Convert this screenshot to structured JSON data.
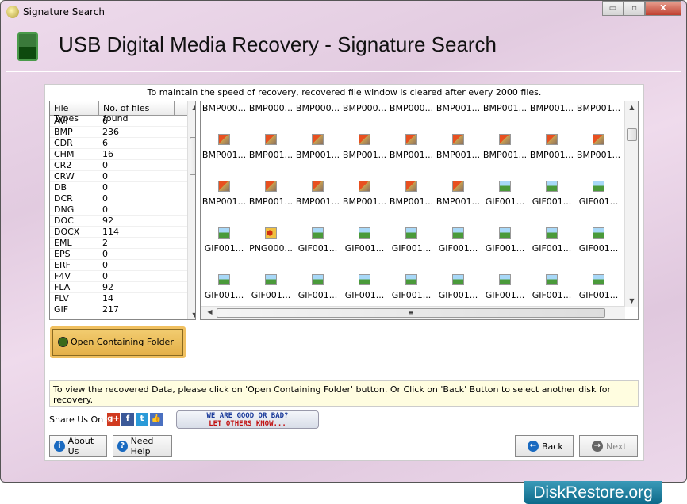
{
  "window": {
    "title": "Signature Search",
    "controls": {
      "minimize": "▭",
      "maximize": "▫",
      "close": "X"
    }
  },
  "header": {
    "title": "USB Digital Media Recovery - Signature Search",
    "icon": "chip-icon"
  },
  "notice": "To maintain the speed of recovery, recovered file window is cleared after every 2000 files.",
  "file_list": {
    "headers": [
      "File Types",
      "No. of files found"
    ],
    "rows": [
      [
        "AVI",
        "6"
      ],
      [
        "BMP",
        "236"
      ],
      [
        "CDR",
        "6"
      ],
      [
        "CHM",
        "16"
      ],
      [
        "CR2",
        "0"
      ],
      [
        "CRW",
        "0"
      ],
      [
        "DB",
        "0"
      ],
      [
        "DCR",
        "0"
      ],
      [
        "DNG",
        "0"
      ],
      [
        "DOC",
        "92"
      ],
      [
        "DOCX",
        "114"
      ],
      [
        "EML",
        "2"
      ],
      [
        "EPS",
        "0"
      ],
      [
        "ERF",
        "0"
      ],
      [
        "F4V",
        "0"
      ],
      [
        "FLA",
        "92"
      ],
      [
        "FLV",
        "14"
      ],
      [
        "GIF",
        "217"
      ]
    ]
  },
  "file_grid": {
    "rows": [
      {
        "icons": false,
        "items": [
          {
            "label": "BMP000...",
            "type": "bmp"
          },
          {
            "label": "BMP000...",
            "type": "bmp"
          },
          {
            "label": "BMP000...",
            "type": "bmp"
          },
          {
            "label": "BMP000...",
            "type": "bmp"
          },
          {
            "label": "BMP000...",
            "type": "bmp"
          },
          {
            "label": "BMP001...",
            "type": "bmp"
          },
          {
            "label": "BMP001...",
            "type": "bmp"
          },
          {
            "label": "BMP001...",
            "type": "bmp"
          },
          {
            "label": "BMP001...",
            "type": "bmp"
          }
        ]
      },
      {
        "icons": true,
        "items": [
          {
            "label": "BMP001...",
            "type": "bmp"
          },
          {
            "label": "BMP001...",
            "type": "bmp"
          },
          {
            "label": "BMP001...",
            "type": "bmp"
          },
          {
            "label": "BMP001...",
            "type": "bmp"
          },
          {
            "label": "BMP001...",
            "type": "bmp"
          },
          {
            "label": "BMP001...",
            "type": "bmp"
          },
          {
            "label": "BMP001...",
            "type": "bmp"
          },
          {
            "label": "BMP001...",
            "type": "bmp"
          },
          {
            "label": "BMP001...",
            "type": "bmp"
          }
        ]
      },
      {
        "icons": true,
        "items": [
          {
            "label": "BMP001...",
            "type": "bmp"
          },
          {
            "label": "BMP001...",
            "type": "bmp"
          },
          {
            "label": "BMP001...",
            "type": "bmp"
          },
          {
            "label": "BMP001...",
            "type": "bmp"
          },
          {
            "label": "BMP001...",
            "type": "bmp"
          },
          {
            "label": "BMP001...",
            "type": "bmp"
          },
          {
            "label": "GIF001...",
            "type": "gif"
          },
          {
            "label": "GIF001...",
            "type": "gif"
          },
          {
            "label": "GIF001...",
            "type": "gif"
          }
        ]
      },
      {
        "icons": true,
        "items": [
          {
            "label": "GIF001...",
            "type": "gif"
          },
          {
            "label": "PNG000...",
            "type": "png"
          },
          {
            "label": "GIF001...",
            "type": "gif"
          },
          {
            "label": "GIF001...",
            "type": "gif"
          },
          {
            "label": "GIF001...",
            "type": "gif"
          },
          {
            "label": "GIF001...",
            "type": "gif"
          },
          {
            "label": "GIF001...",
            "type": "gif"
          },
          {
            "label": "GIF001...",
            "type": "gif"
          },
          {
            "label": "GIF001...",
            "type": "gif"
          }
        ]
      },
      {
        "icons": true,
        "items": [
          {
            "label": "GIF001...",
            "type": "gif"
          },
          {
            "label": "GIF001...",
            "type": "gif"
          },
          {
            "label": "GIF001...",
            "type": "gif"
          },
          {
            "label": "GIF001...",
            "type": "gif"
          },
          {
            "label": "GIF001...",
            "type": "gif"
          },
          {
            "label": "GIF001...",
            "type": "gif"
          },
          {
            "label": "GIF001...",
            "type": "gif"
          },
          {
            "label": "GIF001...",
            "type": "gif"
          },
          {
            "label": "GIF001...",
            "type": "gif"
          }
        ]
      }
    ]
  },
  "buttons": {
    "open_folder": "Open Containing Folder",
    "about": "About Us",
    "help": "Need Help",
    "back": "Back",
    "next": "Next"
  },
  "info": "To view the recovered Data, please click on 'Open Containing Folder' button. Or Click on 'Back' Button to select another disk for recovery.",
  "share": {
    "label": "Share Us On :",
    "icons": [
      {
        "name": "google-plus-icon",
        "glyph": "g+",
        "color": "#d03a20"
      },
      {
        "name": "facebook-icon",
        "glyph": "f",
        "color": "#3b5998"
      },
      {
        "name": "twitter-icon",
        "glyph": "t",
        "color": "#2a9ad8"
      },
      {
        "name": "like-icon",
        "glyph": "👍",
        "color": "#4a70c0"
      }
    ]
  },
  "rating": {
    "line1": "WE ARE GOOD OR BAD?",
    "line2": "LET OTHERS KNOW..."
  },
  "brand": "DiskRestore.org"
}
